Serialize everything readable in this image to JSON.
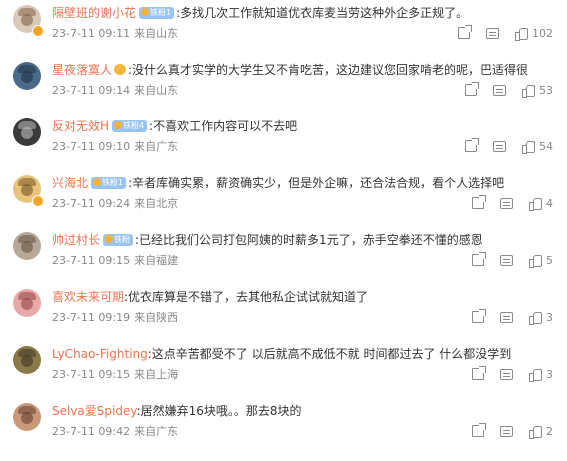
{
  "comments": [
    {
      "user": "隔壁班的谢小花",
      "level": "铁粉1",
      "crown": false,
      "vip": true,
      "text": ":多找几次工作就知道优衣库麦当劳这种外企多正规了。",
      "date": "23-7-11 09:11",
      "loc": "来自山东",
      "likes": "102",
      "avatar_bg": "#d9c9b8",
      "avatar_fg": "#7a5a3e"
    },
    {
      "user": "星夜落寞人",
      "level": "",
      "crown": true,
      "vip": false,
      "text": ":没什么真才实学的大学生又不肯吃苦，这边建议您回家啃老的呢，巴适得很",
      "date": "23-7-11 09:14",
      "loc": "来自山东",
      "likes": "53",
      "avatar_bg": "#4a6a8a",
      "avatar_fg": "#1c2c3c"
    },
    {
      "user": "反对无效H",
      "level": "铁粉4",
      "crown": false,
      "vip": false,
      "text": ":不喜欢工作内容可以不去吧",
      "date": "23-7-11 09:10",
      "loc": "来自广东",
      "likes": "54",
      "avatar_bg": "#3a3a3a",
      "avatar_fg": "#c8c8c8"
    },
    {
      "user": "兴海北",
      "level": "铁粉1",
      "crown": false,
      "vip": true,
      "text": ":辛者库确实累，薪资确实少，但是外企嘛，还合法合规，看个人选择吧",
      "date": "23-7-11 09:24",
      "loc": "来自北京",
      "likes": "4",
      "avatar_bg": "#e8c47a",
      "avatar_fg": "#6a4a20"
    },
    {
      "user": "帅过村长",
      "level": "铁粉",
      "crown": false,
      "vip": false,
      "text": ":已经比我们公司打包阿姨的时薪多1元了，赤手空拳还不懂的感恩",
      "date": "23-7-11 09:15",
      "loc": "来自福建",
      "likes": "5",
      "avatar_bg": "#b8a898",
      "avatar_fg": "#5a4a3a"
    },
    {
      "user": "喜欢未来可期",
      "level": "",
      "crown": false,
      "vip": false,
      "text": ":优衣库算是不错了，去其他私企试试就知道了",
      "date": "23-7-11 09:19",
      "loc": "来自陕西",
      "likes": "3",
      "avatar_bg": "#e8a8a8",
      "avatar_fg": "#8a3a3a"
    },
    {
      "user": "LyChao-Fighting",
      "level": "",
      "crown": false,
      "vip": false,
      "text": ":这点辛苦都受不了 以后就高不成低不就 时间都过去了 什么都没学到",
      "date": "23-7-11 09:15",
      "loc": "来自上海",
      "likes": "3",
      "avatar_bg": "#8a7a4a",
      "avatar_fg": "#3a3020"
    },
    {
      "user": "Selva爱Spidey",
      "level": "",
      "crown": false,
      "vip": false,
      "text": ":居然嫌弃16块哦。。那去8块的",
      "date": "23-7-11 09:42",
      "loc": "来自广东",
      "likes": "2",
      "avatar_bg": "#c89878",
      "avatar_fg": "#5a3a2a"
    }
  ],
  "colors": {
    "username": "#eb7350",
    "text": "#333333",
    "meta": "#888888"
  },
  "icons": {
    "share": "share-icon",
    "comment": "comment-icon",
    "like": "like-icon"
  }
}
